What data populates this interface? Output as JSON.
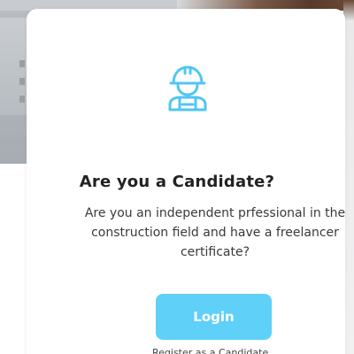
{
  "modal": {
    "icon": "construction-worker-icon",
    "title": "Are you a Candidate?",
    "description": "Are you an independent prfessional in the construction field and have a freelancer certificate?",
    "login_label": "Login",
    "register_label": "Register as a Candidate"
  },
  "colors": {
    "accent": "#5fd0f7",
    "icon": "#4fc6f2",
    "title": "#222222"
  }
}
